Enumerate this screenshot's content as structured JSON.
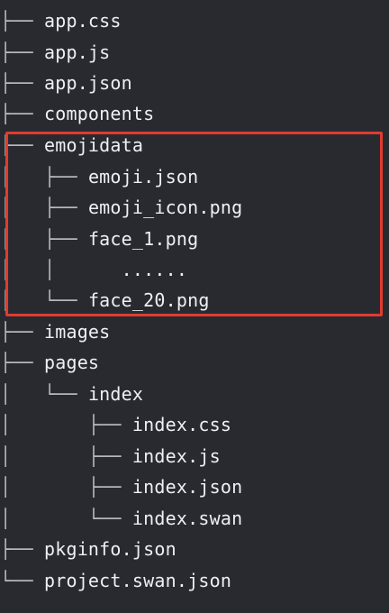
{
  "tree": {
    "lines": [
      {
        "guide": "├── ",
        "name": "app.css"
      },
      {
        "guide": "├── ",
        "name": "app.js"
      },
      {
        "guide": "├── ",
        "name": "app.json"
      },
      {
        "guide": "├── ",
        "name": "components"
      },
      {
        "guide": "├── ",
        "name": "emojidata"
      },
      {
        "guide": "│   ├── ",
        "name": "emoji.json"
      },
      {
        "guide": "│   ├── ",
        "name": "emoji_icon.png"
      },
      {
        "guide": "│   ├── ",
        "name": "face_1.png"
      },
      {
        "guide": "│   │      ",
        "name": "......"
      },
      {
        "guide": "│   └── ",
        "name": "face_20.png"
      },
      {
        "guide": "├── ",
        "name": "images"
      },
      {
        "guide": "├── ",
        "name": "pages"
      },
      {
        "guide": "│   └── ",
        "name": "index"
      },
      {
        "guide": "│       ├── ",
        "name": "index.css"
      },
      {
        "guide": "│       ├── ",
        "name": "index.js"
      },
      {
        "guide": "│       ├── ",
        "name": "index.json"
      },
      {
        "guide": "│       └── ",
        "name": "index.swan"
      },
      {
        "guide": "├── ",
        "name": "pkginfo.json"
      },
      {
        "guide": "└── ",
        "name": "project.swan.json"
      }
    ]
  },
  "highlight": {
    "color": "#e23b2f",
    "target": "emojidata"
  },
  "theme": {
    "background": "#292a30",
    "text": "#eef0f3",
    "guide": "#b9bac0"
  }
}
